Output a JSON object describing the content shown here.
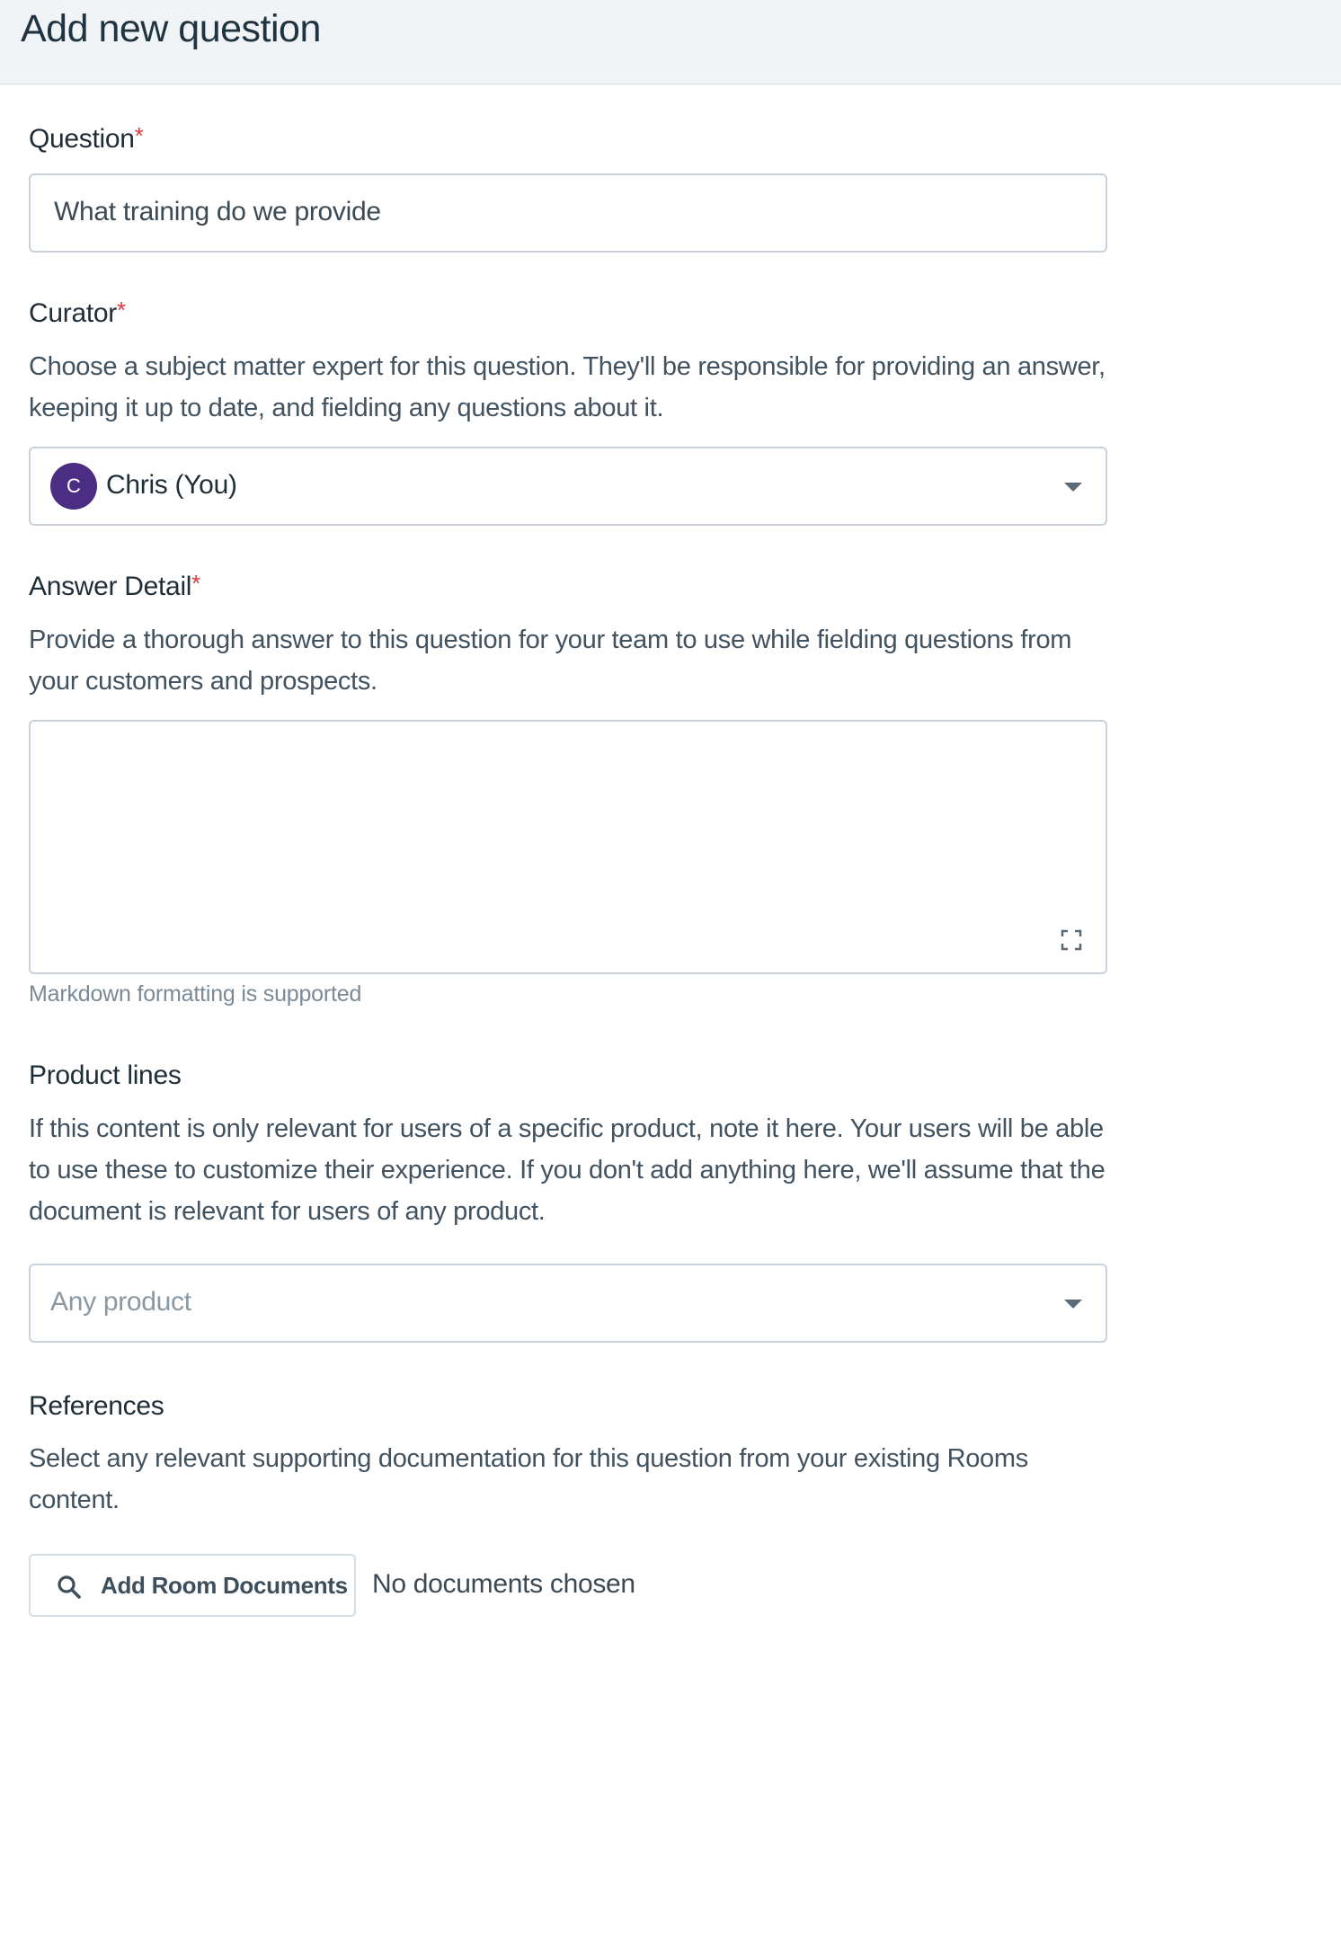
{
  "header": {
    "title": "Add new question"
  },
  "question": {
    "label": "Question",
    "required_mark": "*",
    "value": "What training do we provide"
  },
  "curator": {
    "label": "Curator",
    "required_mark": "*",
    "description": "Choose a subject matter expert for this question. They'll be responsible for providing an answer, keeping it up to date, and fielding any questions about it.",
    "avatar_initial": "C",
    "avatar_color": "#4b2e83",
    "selected": "Chris (You)",
    "icon": "chevron-down-icon"
  },
  "answer": {
    "label": "Answer Detail",
    "required_mark": "*",
    "description": "Provide a thorough answer to this question for your team to use while fielding questions from your customers and prospects.",
    "value": "",
    "hint": "Markdown formatting is supported",
    "icon": "expand-icon"
  },
  "product_lines": {
    "label": "Product lines",
    "description": "If this content is only relevant for users of a specific product, note it here. Your users will be able to use these to customize their experience. If you don't add anything here, we'll assume that the document is relevant for users of any product.",
    "placeholder": "Any product",
    "icon": "chevron-down-icon"
  },
  "references": {
    "label": "References",
    "description": "Select any relevant supporting documentation for this question from your existing Rooms content.",
    "button_label": "Add Room Documents",
    "button_icon": "search-icon",
    "status": "No documents chosen"
  },
  "colors": {
    "required": "#d83b3b",
    "border": "#c9d2da",
    "header_bg": "#f1f4f7"
  }
}
